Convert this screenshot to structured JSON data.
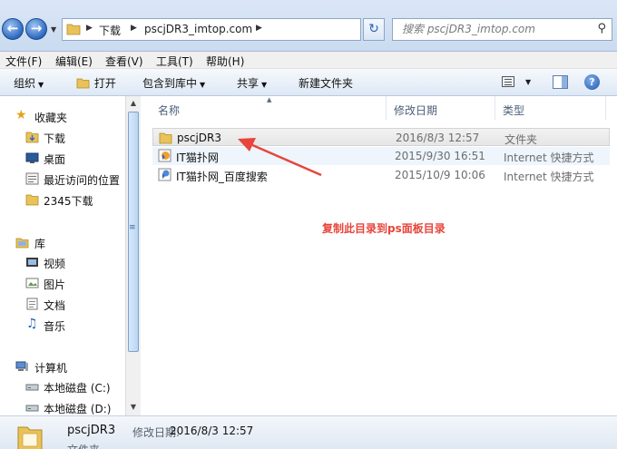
{
  "breadcrumb": [
    "下载",
    "pscjDR3_imtop.com"
  ],
  "search": {
    "placeholder": "搜索 pscjDR3_imtop.com"
  },
  "menu": [
    "文件(F)",
    "编辑(E)",
    "查看(V)",
    "工具(T)",
    "帮助(H)"
  ],
  "toolbar": {
    "organize": "组织",
    "open": "打开",
    "include": "包含到库中",
    "share": "共享",
    "new_folder": "新建文件夹"
  },
  "sidebar": {
    "favorites": {
      "label": "收藏夹",
      "items": [
        "下载",
        "桌面",
        "最近访问的位置",
        "2345下载"
      ]
    },
    "libraries": {
      "label": "库",
      "items": [
        "视频",
        "图片",
        "文档",
        "音乐"
      ]
    },
    "computer": {
      "label": "计算机",
      "items": [
        "本地磁盘 (C:)",
        "本地磁盘 (D:)"
      ]
    }
  },
  "columns": {
    "name": "名称",
    "modified": "修改日期",
    "type": "类型"
  },
  "files": [
    {
      "name": "pscjDR3",
      "date": "2016/8/3 12:57",
      "type": "文件夹",
      "icon": "folder-icon"
    },
    {
      "name": "IT猫扑网",
      "date": "2015/9/30 16:51",
      "type": "Internet 快捷方式",
      "icon": "internet-shortcut-icon"
    },
    {
      "name": "IT猫扑网_百度搜索",
      "date": "2015/10/9 10:06",
      "type": "Internet 快捷方式",
      "icon": "internet-shortcut-icon"
    }
  ],
  "annotation": {
    "text": "复制此目录到ps面板目录",
    "color": "#e8453c"
  },
  "details": {
    "name": "pscjDR3",
    "label": "修改日期:",
    "value": "2016/8/3 12:57",
    "type": "文件夹"
  },
  "colors": {
    "accent": "#2d69c0",
    "selection": "#e6e6e6",
    "arrow": "#e8453c"
  }
}
